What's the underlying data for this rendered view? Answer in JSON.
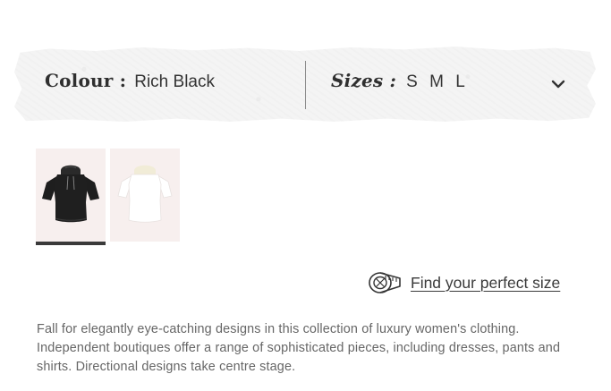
{
  "options": {
    "colour_label": "Colour :",
    "colour_value": "Rich Black",
    "sizes_label": "Sizes :",
    "sizes_value": "S M L",
    "chevron_icon": "chevron-down-icon"
  },
  "thumbnails": [
    {
      "name": "Rich Black hooded crop top",
      "color": "#1e1e1e",
      "selected": true
    },
    {
      "name": "White crop top",
      "color": "#ffffff",
      "selected": false
    }
  ],
  "size_guide": {
    "icon": "measuring-tape-icon",
    "label": "Find your perfect size"
  },
  "description": "Fall for elegantly eye-catching designs in this collection of luxury women's clothing. Independent boutiques offer a range of sophisticated pieces, including dresses, pants and shirts. Directional designs take centre stage.",
  "colors": {
    "text": "#2a2a2a",
    "muted": "#666666",
    "banner": "#f4f4f4",
    "thumb_bg": "#f7efee",
    "active_underline": "#3a3a3a"
  }
}
